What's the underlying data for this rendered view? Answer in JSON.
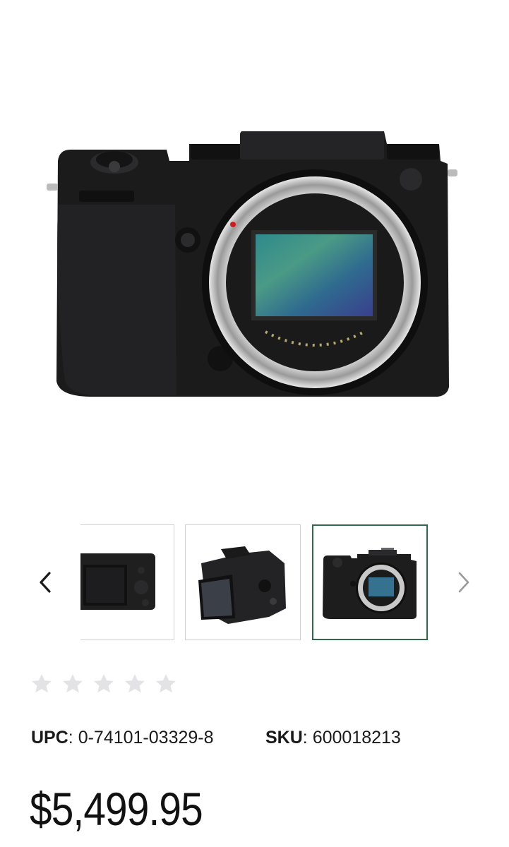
{
  "product": {
    "image_alt": "camera-body-front",
    "carousel": {
      "prev_icon": "chevron-left-icon",
      "next_icon": "chevron-right-icon",
      "thumbnails": [
        {
          "name": "camera-back-view"
        },
        {
          "name": "camera-angled-back-view"
        },
        {
          "name": "camera-front-view",
          "selected": true
        }
      ],
      "selected_border_color": "#2f6b4a"
    },
    "rating": {
      "stars_filled": 0,
      "stars_total": 5,
      "star_color": "#e3e3e6"
    },
    "upc_label": "UPC",
    "upc_value": ": 0-74101-03329-8",
    "sku_label": "SKU",
    "sku_value": ": 600018213",
    "price": "$5,499.95"
  }
}
